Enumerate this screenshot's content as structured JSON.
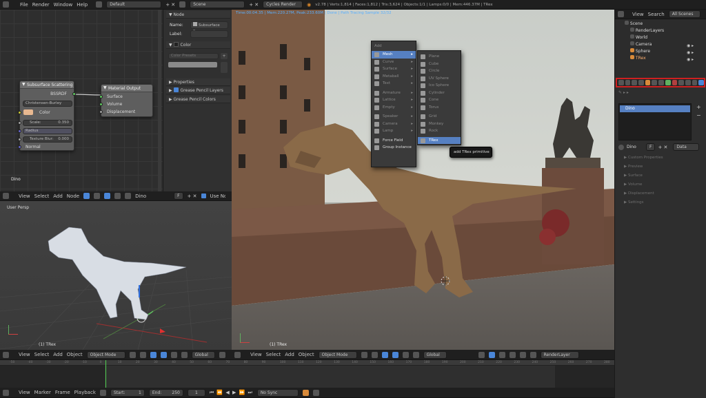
{
  "top_menu": [
    "File",
    "Render",
    "Window",
    "Help"
  ],
  "screen_layout": "Default",
  "scene": "Scene",
  "render_engine": "Cycles Render",
  "stats": "v2.78 | Verts:1,814 | Faces:1,812 | Tris:3,624 | Objects:1/1 | Lamps:0/0 | Mem:446.37M | TRex",
  "node_editor": {
    "material_name": "Dino",
    "header_items": [
      "View",
      "Select",
      "Add",
      "Node"
    ],
    "use_nodes": "Use Nodes",
    "sss_node": {
      "title": "Subsurface Scattering",
      "output": "BSSRDF",
      "falloff": "Christensen-Burley",
      "color": "Color",
      "scale_label": "Scale:",
      "scale_value": "0.350",
      "radius": "Radius",
      "texture_blur_label": "Texture Blur:",
      "texture_blur_value": "0.000",
      "normal": "Normal"
    },
    "output_node": {
      "title": "Material Output",
      "inputs": [
        "Surface",
        "Volume",
        "Displacement"
      ]
    }
  },
  "node_panel": {
    "node_header": "Node",
    "name_label": "Name:",
    "name_value": "Subsurface Sc...",
    "label_label": "Label:",
    "color_header": "Color",
    "color_presets": "Color Presets",
    "properties_header": "Properties",
    "grease_pencil_layers": "Grease Pencil Layers",
    "grease_pencil_colors": "Grease Pencil Colors"
  },
  "viewport_left": {
    "label": "User Persp",
    "object": "(1) TRex",
    "header_items": [
      "View",
      "Select",
      "Add",
      "Object"
    ],
    "mode": "Object Mode",
    "orientation": "Global"
  },
  "viewport_main": {
    "render_status": "Time:00:04.35 | Mem:220.27M, Peak:233.60M | Done | Path Tracing Sample 32/32",
    "object": "(1) TRex",
    "header_items": [
      "View",
      "Select",
      "Add",
      "Object"
    ],
    "mode": "Object Mode",
    "orientation": "Global",
    "render_layer": "RenderLayer"
  },
  "add_menu": {
    "title": "Add",
    "items": [
      {
        "label": "Mesh",
        "state": "highlight"
      },
      {
        "label": "Curve",
        "state": "dim"
      },
      {
        "label": "Surface",
        "state": "dim"
      },
      {
        "label": "Metaball",
        "state": "dim"
      },
      {
        "label": "Text",
        "state": "dim"
      },
      {
        "label": "Armature",
        "state": "dim"
      },
      {
        "label": "Lattice",
        "state": "dim"
      },
      {
        "label": "Empty",
        "state": "dim"
      },
      {
        "label": "Speaker",
        "state": "dim"
      },
      {
        "label": "Camera",
        "state": "dim"
      },
      {
        "label": "Lamp",
        "state": "dim"
      },
      {
        "label": "Force Field",
        "state": "normal"
      },
      {
        "label": "Group Instance",
        "state": "normal"
      }
    ]
  },
  "mesh_submenu": {
    "items": [
      {
        "label": "Plane",
        "state": "dim"
      },
      {
        "label": "Cube",
        "state": "dim"
      },
      {
        "label": "Circle",
        "state": "dim"
      },
      {
        "label": "UV Sphere",
        "state": "dim"
      },
      {
        "label": "Ico Sphere",
        "state": "dim"
      },
      {
        "label": "Cylinder",
        "state": "dim"
      },
      {
        "label": "Cone",
        "state": "dim"
      },
      {
        "label": "Torus",
        "state": "dim"
      },
      {
        "label": "Grid",
        "state": "dim"
      },
      {
        "label": "Monkey",
        "state": "dim"
      },
      {
        "label": "Rock",
        "state": "dim"
      },
      {
        "label": "TRex",
        "state": "highlight"
      }
    ]
  },
  "tooltip": "add TRex primitive",
  "outliner": {
    "header_items": [
      "View",
      "Search",
      "All Scenes"
    ],
    "rows": [
      "Scene",
      "RenderLayers",
      "World",
      "Camera",
      "Sphere",
      "TRex"
    ]
  },
  "material_props": {
    "slot": "Dino",
    "material": "Dino",
    "data_dropdown": "Data",
    "f_label": "F",
    "panels": [
      "Custom Properties",
      "Preview",
      "Surface",
      "Volume",
      "Displacement",
      "Settings"
    ]
  },
  "timeline": {
    "header_items": [
      "View",
      "Marker",
      "Frame",
      "Playback"
    ],
    "start_label": "Start:",
    "start_value": "1",
    "end_label": "End:",
    "end_value": "250",
    "current_frame": "1",
    "sync": "No Sync",
    "ticks": [
      "-50",
      "-40",
      "-30",
      "-20",
      "-10",
      "0",
      "10",
      "20",
      "30",
      "40",
      "50",
      "60",
      "70",
      "80",
      "90",
      "100",
      "110",
      "120",
      "130",
      "140",
      "150",
      "160",
      "170",
      "180",
      "190",
      "200",
      "210",
      "220",
      "230",
      "240",
      "250",
      "260",
      "270",
      "280"
    ]
  },
  "colors": {
    "accent": "#5680c2",
    "highlight_red": "#d02020",
    "sss_color_swatch": "#e8b890"
  }
}
